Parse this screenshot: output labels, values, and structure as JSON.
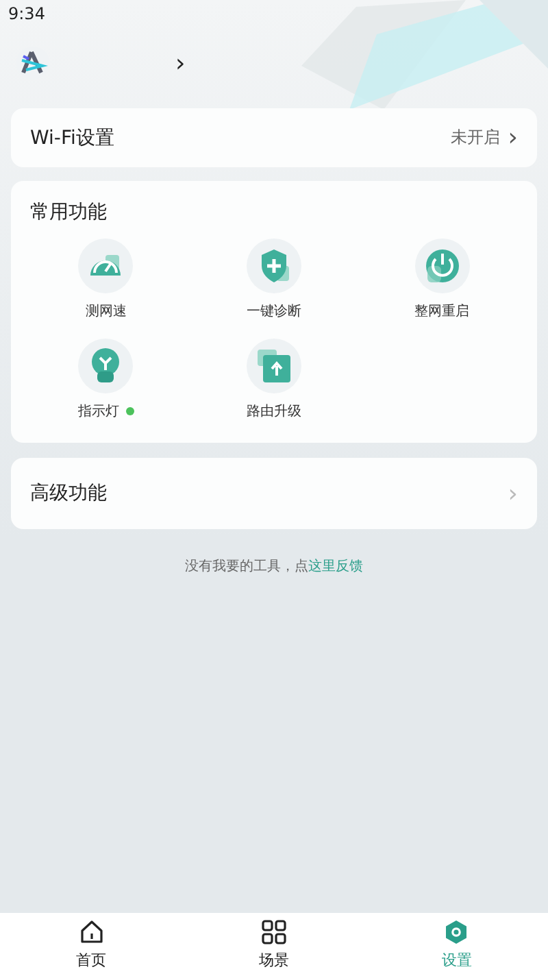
{
  "status_bar": {
    "time": "9:34"
  },
  "header": {
    "chevron": "›"
  },
  "wifi_row": {
    "label": "Wi-Fi设置",
    "value": "未开启",
    "chevron": "›"
  },
  "common": {
    "title": "常用功能",
    "items": [
      {
        "kind": "speed",
        "label": "测网速"
      },
      {
        "kind": "shield",
        "label": "一键诊断"
      },
      {
        "kind": "power",
        "label": "整网重启"
      },
      {
        "kind": "bulb",
        "label": "指示灯",
        "color": "#4cc25c"
      },
      {
        "kind": "upgrade",
        "label": "路由升级"
      }
    ]
  },
  "advanced_row": {
    "label": "高级功能",
    "chevron": "›"
  },
  "feedback": {
    "text": "没有我要的工具，点",
    "link": "这里反馈"
  },
  "tabs": [
    {
      "kind": "home",
      "label": "首页",
      "selected": false
    },
    {
      "kind": "grid",
      "label": "场景",
      "selected": false
    },
    {
      "kind": "gear",
      "label": "设置",
      "selected": true
    }
  ]
}
